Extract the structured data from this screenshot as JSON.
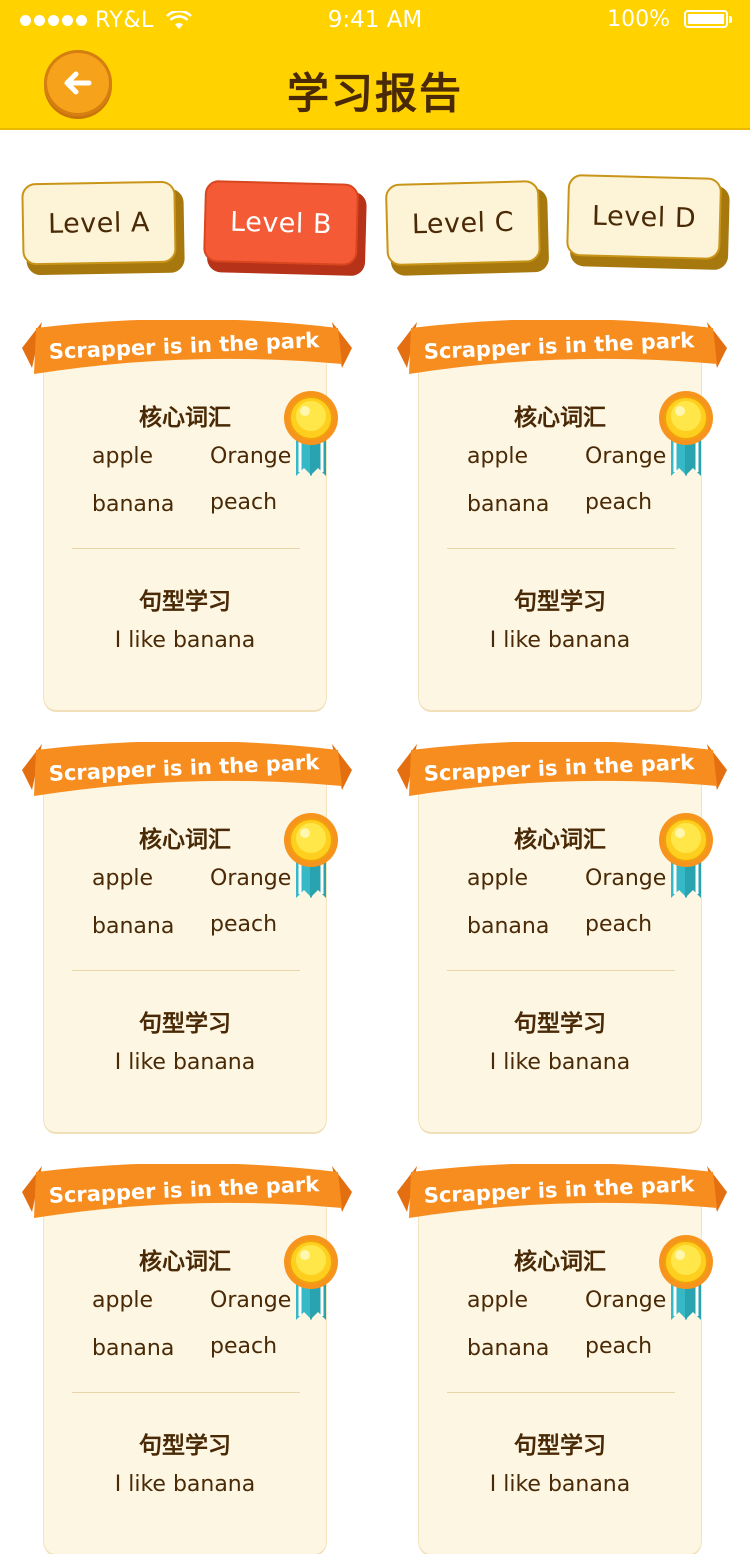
{
  "status_bar": {
    "carrier": "RY&L",
    "time": "9:41 AM",
    "battery": "100%"
  },
  "header": {
    "title": "学习报告",
    "back_icon": "arrow-left-icon"
  },
  "levels": [
    {
      "label": "Level A",
      "active": false
    },
    {
      "label": "Level B",
      "active": true
    },
    {
      "label": "Level C",
      "active": false
    },
    {
      "label": "Level D",
      "active": false
    }
  ],
  "cards": [
    {
      "ribbon": "Scrapper is in the park",
      "vocab_title": "核心词汇",
      "words": [
        "apple",
        "Orange",
        "banana",
        "peach"
      ],
      "sentence_title": "句型学习",
      "sentence": "I like banana"
    },
    {
      "ribbon": "Scrapper is in the park",
      "vocab_title": "核心词汇",
      "words": [
        "apple",
        "Orange",
        "banana",
        "peach"
      ],
      "sentence_title": "句型学习",
      "sentence": "I like banana"
    },
    {
      "ribbon": "Scrapper is in the park",
      "vocab_title": "核心词汇",
      "words": [
        "apple",
        "Orange",
        "banana",
        "peach"
      ],
      "sentence_title": "句型学习",
      "sentence": "I like banana"
    },
    {
      "ribbon": "Scrapper is in the park",
      "vocab_title": "核心词汇",
      "words": [
        "apple",
        "Orange",
        "banana",
        "peach"
      ],
      "sentence_title": "句型学习",
      "sentence": "I like banana"
    },
    {
      "ribbon": "Scrapper is in the park",
      "vocab_title": "核心词汇",
      "words": [
        "apple",
        "Orange",
        "banana",
        "peach"
      ],
      "sentence_title": "句型学习",
      "sentence": "I like banana"
    },
    {
      "ribbon": "Scrapper is in the park",
      "vocab_title": "核心词汇",
      "words": [
        "apple",
        "Orange",
        "banana",
        "peach"
      ],
      "sentence_title": "句型学习",
      "sentence": "I like banana"
    }
  ],
  "colors": {
    "header_bg": "#ffd200",
    "accent_orange": "#f78d1e",
    "active_tab": "#f45a36",
    "card_bg": "#fdf6e3",
    "text_brown": "#4a2a06"
  }
}
